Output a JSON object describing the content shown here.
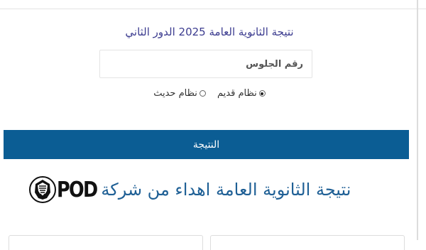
{
  "form": {
    "title": "نتيجة الثانوية العامة 2025 الدور الثاني",
    "seat_placeholder": "رقم الجلوس",
    "radio_old": "نظام قديم",
    "radio_new": "نظام حديث",
    "selected_system": "old",
    "submit_label": "النتيجة"
  },
  "banner": {
    "text": "نتيجة الثانوية العامة اهداء من شركة",
    "logo_text": "POD"
  },
  "colors": {
    "button_bg": "#0b5d94",
    "banner_text": "#1e5f95",
    "title_text": "#3b3b8f"
  }
}
